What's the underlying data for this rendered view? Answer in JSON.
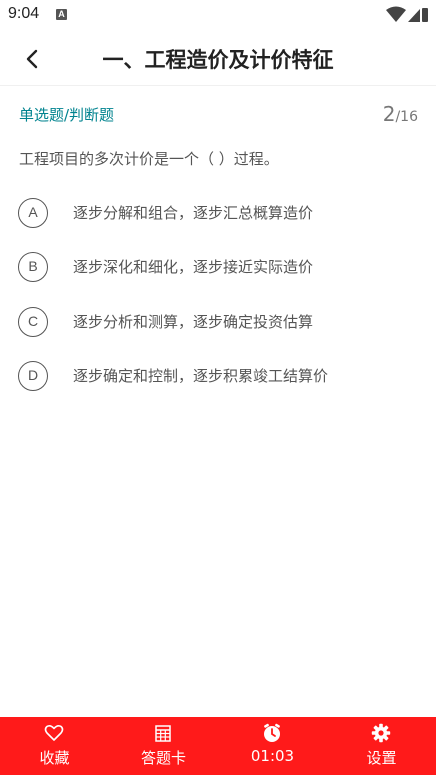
{
  "status_bar": {
    "time": "9:04",
    "notification_icon": "A"
  },
  "header": {
    "title": "一、工程造价及计价特征",
    "back_icon": "chevron-left-icon"
  },
  "question": {
    "type_label": "单选题/判断题",
    "current": "2",
    "total": "/16",
    "text": "工程项目的多次计价是一个（  ）过程。",
    "options": [
      {
        "letter": "A",
        "text": "逐步分解和组合，逐步汇总概算造价"
      },
      {
        "letter": "B",
        "text": "逐步深化和细化，逐步接近实际造价"
      },
      {
        "letter": "C",
        "text": "逐步分析和测算，逐步确定投资估算"
      },
      {
        "letter": "D",
        "text": "逐步确定和控制，逐步积累竣工结算价"
      }
    ]
  },
  "bottom_bar": {
    "color": "#ff1a1a",
    "tabs": [
      {
        "label": "收藏",
        "icon": "heart-icon"
      },
      {
        "label": "答题卡",
        "icon": "grid-icon"
      },
      {
        "label": "01:03",
        "icon": "clock-icon"
      },
      {
        "label": "设置",
        "icon": "gear-icon"
      }
    ]
  }
}
